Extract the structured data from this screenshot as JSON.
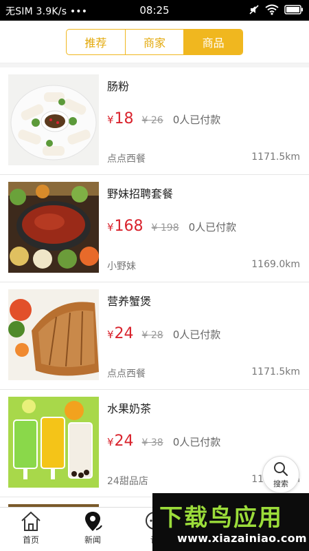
{
  "status_bar": {
    "left": "无SIM 3.9K/s •••",
    "time": "08:25"
  },
  "tabs": [
    {
      "label": "推荐",
      "active": false
    },
    {
      "label": "商家",
      "active": false
    },
    {
      "label": "商品",
      "active": true
    }
  ],
  "colors": {
    "accent": "#f0b71f",
    "price": "#d9232d"
  },
  "products": [
    {
      "name": "肠粉",
      "currency": "¥",
      "price": "18",
      "original_price": "¥ 26",
      "paid": "0人已付款",
      "shop": "点点西餐",
      "distance": "1171.5km"
    },
    {
      "name": "野妹招聘套餐",
      "currency": "¥",
      "price": "168",
      "original_price": "¥ 198",
      "paid": "0人已付款",
      "shop": "小野妹",
      "distance": "1169.0km"
    },
    {
      "name": "营养蟹煲",
      "currency": "¥",
      "price": "24",
      "original_price": "¥ 28",
      "paid": "0人已付款",
      "shop": "点点西餐",
      "distance": "1171.5km"
    },
    {
      "name": "水果奶茶",
      "currency": "¥",
      "price": "24",
      "original_price": "¥ 38",
      "paid": "0人已付款",
      "shop": "24甜品店",
      "distance": "1171.5km"
    }
  ],
  "search_button": {
    "label": "搜索",
    "icon": "search-icon"
  },
  "bottom_nav": [
    {
      "label": "首页",
      "icon": "home-icon"
    },
    {
      "label": "新闻",
      "icon": "location-pin-icon"
    },
    {
      "label": "论",
      "icon": "chat-icon"
    }
  ],
  "watermark": {
    "title": "下载鸟应用",
    "url": "www.xiazainiao.com"
  }
}
